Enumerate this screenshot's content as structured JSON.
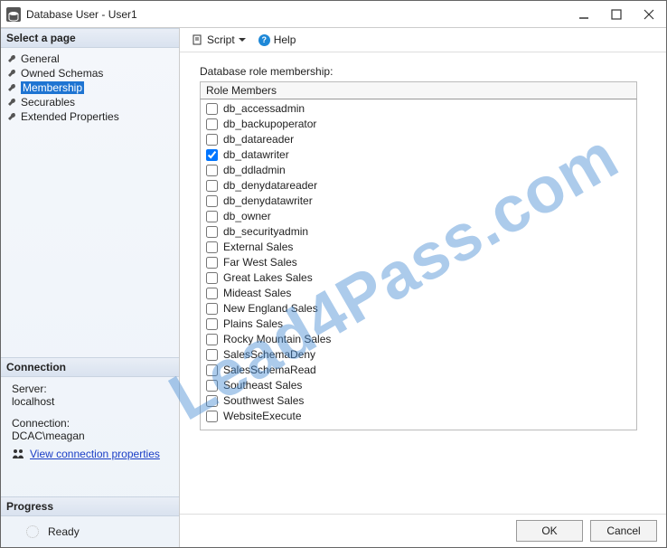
{
  "window": {
    "title": "Database User - User1"
  },
  "sidebar": {
    "pagesTitle": "Select a page",
    "pages": [
      {
        "label": "General"
      },
      {
        "label": "Owned Schemas"
      },
      {
        "label": "Membership"
      },
      {
        "label": "Securables"
      },
      {
        "label": "Extended Properties"
      }
    ],
    "selectedIndex": 2,
    "connectionTitle": "Connection",
    "serverLabel": "Server:",
    "serverValue": "localhost",
    "connLabel": "Connection:",
    "connValue": "DCAC\\meagan",
    "viewConnProps": "View connection properties",
    "progressTitle": "Progress",
    "progressStatus": "Ready"
  },
  "toolbar": {
    "script": "Script",
    "help": "Help"
  },
  "main": {
    "groupLabel": "Database role membership:",
    "columnHeader": "Role Members",
    "roles": [
      {
        "label": "db_accessadmin",
        "checked": false
      },
      {
        "label": "db_backupoperator",
        "checked": false
      },
      {
        "label": "db_datareader",
        "checked": false
      },
      {
        "label": "db_datawriter",
        "checked": true
      },
      {
        "label": "db_ddladmin",
        "checked": false
      },
      {
        "label": "db_denydatareader",
        "checked": false
      },
      {
        "label": "db_denydatawriter",
        "checked": false
      },
      {
        "label": "db_owner",
        "checked": false
      },
      {
        "label": "db_securityadmin",
        "checked": false
      },
      {
        "label": "External Sales",
        "checked": false
      },
      {
        "label": "Far West Sales",
        "checked": false
      },
      {
        "label": "Great Lakes Sales",
        "checked": false
      },
      {
        "label": "Mideast Sales",
        "checked": false
      },
      {
        "label": "New England Sales",
        "checked": false
      },
      {
        "label": "Plains Sales",
        "checked": false
      },
      {
        "label": "Rocky Mountain Sales",
        "checked": false
      },
      {
        "label": "SalesSchemaDeny",
        "checked": false
      },
      {
        "label": "SalesSchemaRead",
        "checked": false
      },
      {
        "label": "Southeast Sales",
        "checked": false
      },
      {
        "label": "Southwest Sales",
        "checked": false
      },
      {
        "label": "WebsiteExecute",
        "checked": false
      }
    ]
  },
  "footer": {
    "ok": "OK",
    "cancel": "Cancel"
  },
  "watermark": "Lead4Pass.com"
}
